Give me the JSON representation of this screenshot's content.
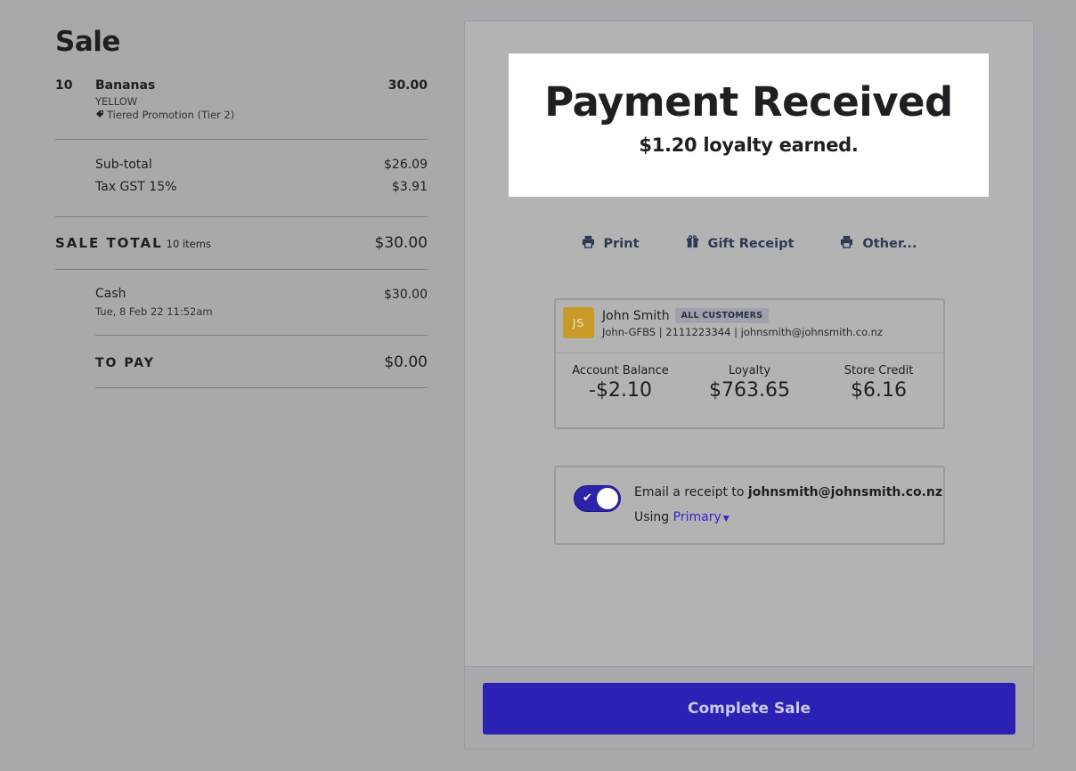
{
  "sale": {
    "title": "Sale",
    "items": [
      {
        "qty": "10",
        "name": "Bananas",
        "variant": "YELLOW",
        "promotion": "Tiered Promotion (Tier 2)",
        "price": "30.00"
      }
    ],
    "subtotal_label": "Sub-total",
    "subtotal_value": "$26.09",
    "tax_label": "Tax GST 15%",
    "tax_value": "$3.91",
    "total_label": "SALE TOTAL",
    "total_count": "10 items",
    "total_value": "$30.00",
    "payment_method": "Cash",
    "payment_date": "Tue, 8 Feb 22 11:52am",
    "payment_value": "$30.00",
    "to_pay_label": "TO PAY",
    "to_pay_value": "$0.00"
  },
  "receipt": {
    "headline": "Payment Received",
    "loyalty_text": "$1.20 loyalty earned."
  },
  "actions": {
    "print": "Print",
    "gift_receipt": "Gift Receipt",
    "other": "Other..."
  },
  "customer": {
    "initials": "JS",
    "name": "John Smith",
    "group_badge": "ALL CUSTOMERS",
    "details": "John-GFBS | 2111223344 | johnsmith@johnsmith.co.nz",
    "account_balance_label": "Account Balance",
    "account_balance": "-$2.10",
    "loyalty_label": "Loyalty",
    "loyalty": "$763.65",
    "store_credit_label": "Store Credit",
    "store_credit": "$6.16"
  },
  "email": {
    "prefix": "Email a receipt to",
    "address": "johnsmith@johnsmith.co.nz",
    "using_label": "Using",
    "template": "Primary",
    "enabled": true
  },
  "footer": {
    "complete_label": "Complete Sale"
  },
  "colors": {
    "background": "#a9a8ac",
    "accent": "#2b22b3",
    "avatar": "#c79a2a"
  }
}
